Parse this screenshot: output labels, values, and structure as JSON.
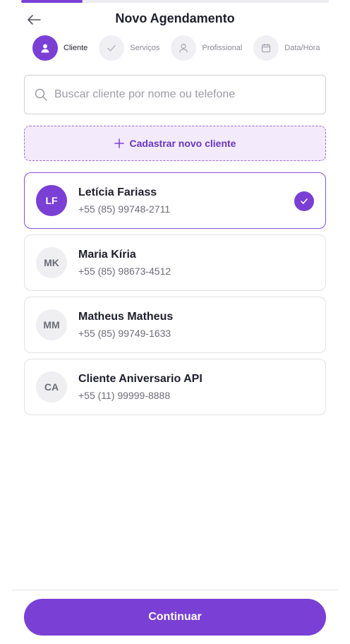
{
  "header": {
    "title": "Novo Agendamento"
  },
  "progress": {
    "fraction": 0.2
  },
  "steps": [
    {
      "label": "Cliente",
      "state": "active",
      "icon": "user-icon"
    },
    {
      "label": "Serviços",
      "state": "pending",
      "icon": "check-icon"
    },
    {
      "label": "Profissional",
      "state": "pending",
      "icon": "user-outline-icon"
    },
    {
      "label": "Data/Hora",
      "state": "pending",
      "icon": "calendar-icon"
    }
  ],
  "search": {
    "placeholder": "Buscar cliente por nome ou telefone",
    "value": ""
  },
  "new_client": {
    "label": "Cadastrar novo cliente"
  },
  "clients": [
    {
      "initials": "LF",
      "name": "Letícia Fariass",
      "phone": "+55 (85) 99748-2711",
      "selected": true
    },
    {
      "initials": "MK",
      "name": "Maria Kíria",
      "phone": "+55 (85) 98673-4512",
      "selected": false
    },
    {
      "initials": "MM",
      "name": "Matheus Matheus",
      "phone": "+55 (85) 99749-1633",
      "selected": false
    },
    {
      "initials": "CA",
      "name": "Cliente Aniversario API",
      "phone": "+55 (11) 99999-8888",
      "selected": false
    }
  ],
  "footer": {
    "continue_label": "Continuar"
  },
  "colors": {
    "accent": "#7a3fd4",
    "accent_light": "#f3eafb",
    "border": "#e2e2e8"
  }
}
